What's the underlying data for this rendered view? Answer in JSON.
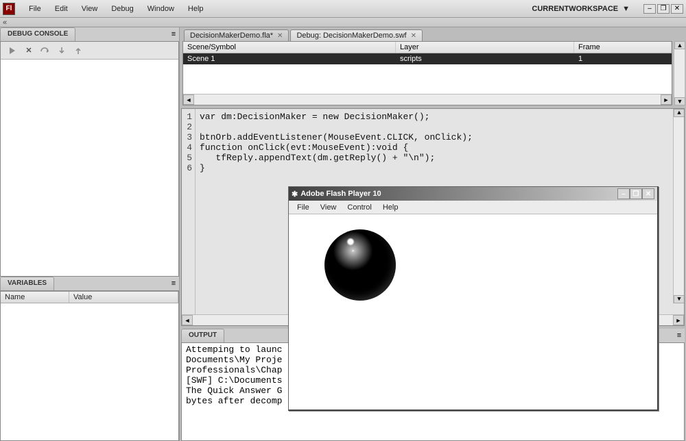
{
  "app": {
    "icon_label": "Fl"
  },
  "menubar": {
    "items": [
      "File",
      "Edit",
      "View",
      "Debug",
      "Window",
      "Help"
    ],
    "workspace_label": "CURRENTWORKSPACE"
  },
  "window_buttons": {
    "min": "–",
    "restore": "❐",
    "close": "✕"
  },
  "collapse_indicator": "«",
  "debug_console": {
    "tab_label": "DEBUG CONSOLE"
  },
  "variables": {
    "tab_label": "VARIABLES",
    "columns": [
      "Name",
      "Value"
    ]
  },
  "tabs": [
    {
      "label": "DecisionMakerDemo.fla*",
      "active": false
    },
    {
      "label": "Debug: DecisionMakerDemo.swf",
      "active": true
    }
  ],
  "scene_panel": {
    "columns": [
      "Scene/Symbol",
      "Layer",
      "Frame"
    ],
    "row": {
      "scene": "Scene 1",
      "layer": "scripts",
      "frame": "1"
    }
  },
  "code": {
    "lines": [
      "var dm:DecisionMaker = new DecisionMaker();",
      "",
      "btnOrb.addEventListener(MouseEvent.CLICK, onClick);",
      "function onClick(evt:MouseEvent):void {",
      "   tfReply.appendText(dm.getReply() + \"\\n\");",
      "}"
    ]
  },
  "output": {
    "tab_label": "OUTPUT",
    "lines": [
      "Attemping to launc",
      "Documents\\My Proje",
      "Professionals\\Chap",
      "[SWF] C:\\Documents",
      "The Quick Answer G",
      "bytes after decomp"
    ]
  },
  "flash_player": {
    "title": "Adobe Flash Player 10",
    "menu": [
      "File",
      "View",
      "Control",
      "Help"
    ]
  },
  "scroll_arrows": {
    "left": "◄",
    "right": "►",
    "up": "▲",
    "down": "▼"
  }
}
